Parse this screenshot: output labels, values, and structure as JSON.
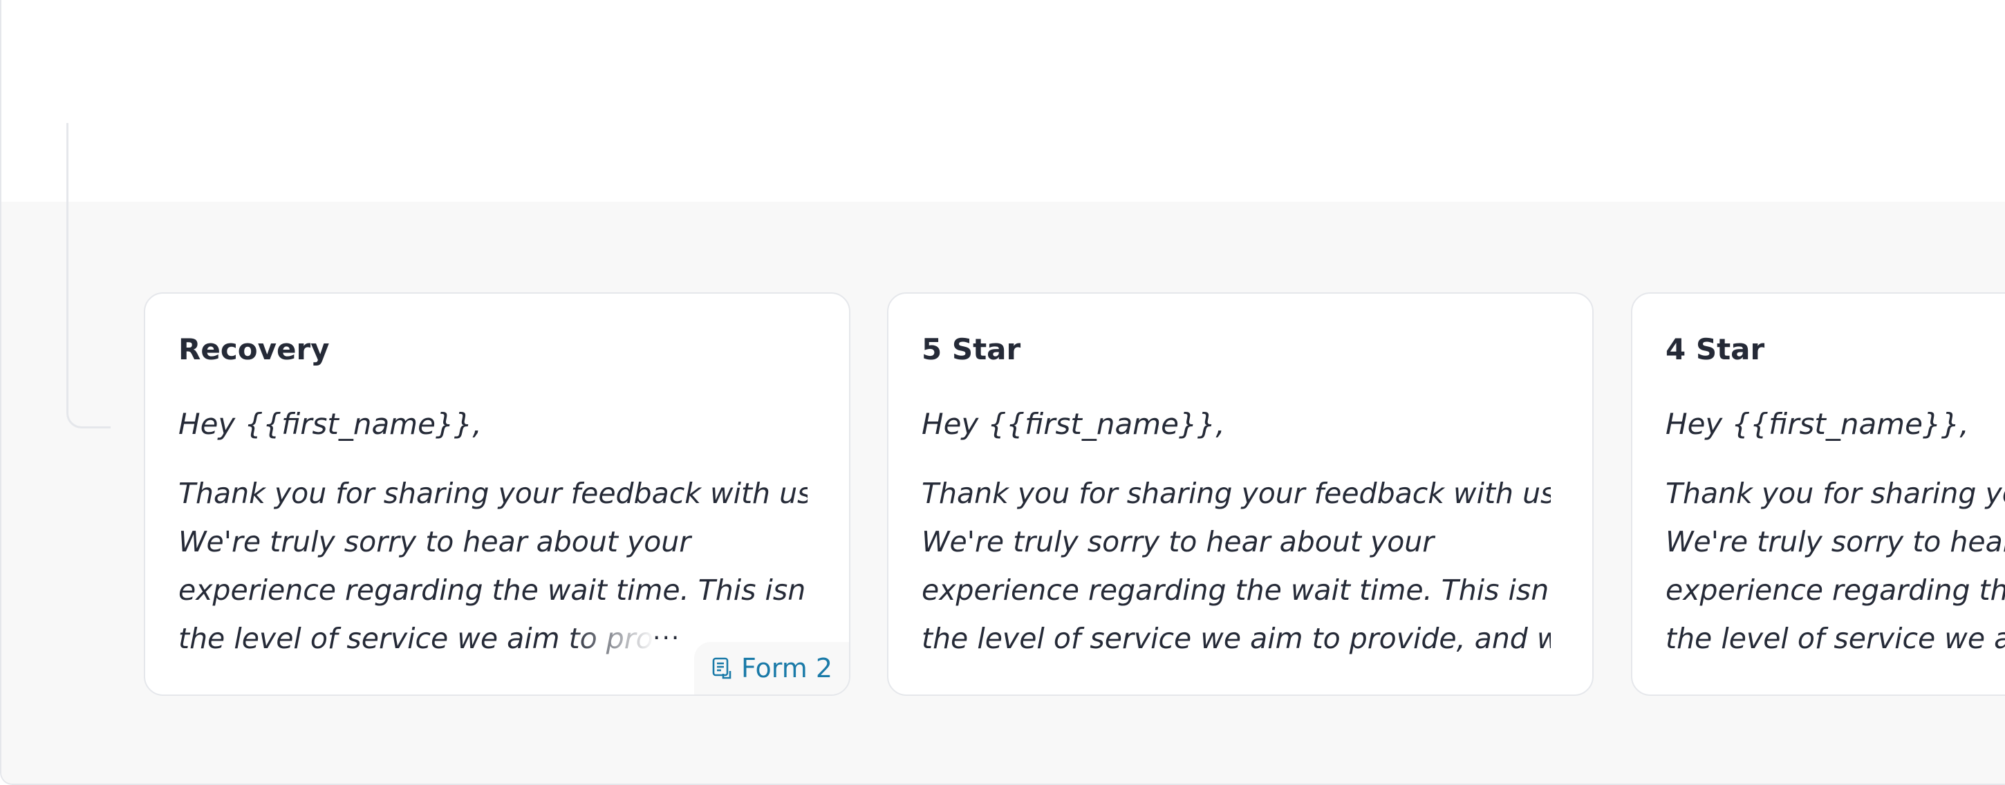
{
  "cards": [
    {
      "title": "Recovery",
      "greeting": "Hey {{first_name}},",
      "lines": [
        "Thank you for sharing your feedback with us.",
        "We're truly sorry to hear about your",
        "experience regarding the wait time. This isn't",
        "the level of service we aim to provide, and we"
      ],
      "more_label": "...",
      "badge": {
        "icon": "form-icon",
        "label": "Form 2"
      }
    },
    {
      "title": "5 Star",
      "greeting": "Hey {{first_name}},",
      "lines": [
        "Thank you for sharing your feedback with us.",
        "We're truly sorry to hear about your",
        "experience regarding the wait time. This isn't",
        "the level of service we aim to provide, and w..."
      ]
    },
    {
      "title": "4 Star",
      "greeting": "Hey {{first_name}},",
      "lines": [
        "Thank you for sharing your feedback with us.",
        "We're truly sorry to hear about your",
        "experience regarding the wait time. This isn't",
        "the level of service we aim to provide, and w..."
      ]
    }
  ],
  "colors": {
    "text": "#252a37",
    "badge_text": "#1a7aa8",
    "panel_bg": "#f8f8f8",
    "border": "#e5e7eb"
  }
}
